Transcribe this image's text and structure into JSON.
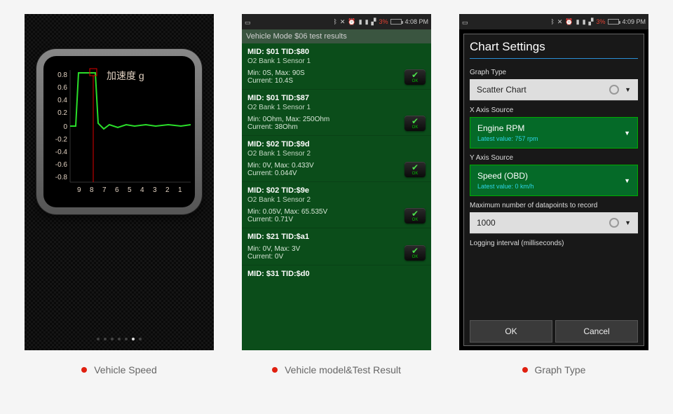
{
  "statusbar": {
    "battery_pct": "3%",
    "time2": "4:08 PM",
    "time3": "4:09 PM"
  },
  "phone1": {
    "chart_title": "加速度 g",
    "y_ticks": [
      "0.8",
      "0.6",
      "0.4",
      "0.2",
      "0",
      "-0.2",
      "-0.4",
      "-0.6",
      "-0.8"
    ],
    "x_ticks": [
      "9",
      "8",
      "7",
      "6",
      "5",
      "4",
      "3",
      "2",
      "1"
    ]
  },
  "chart_data": {
    "type": "line",
    "title": "加速度 g",
    "xlabel": "",
    "ylabel": "g",
    "ylim": [
      -0.8,
      0.8
    ],
    "x": [
      9,
      8,
      7,
      6,
      5,
      4,
      3,
      2,
      1
    ],
    "values": [
      0.0,
      0.82,
      0.82,
      0.05,
      0.05,
      0.05,
      0.05,
      0.05,
      0.05
    ],
    "annotations": [
      "high plateau between x≈9 and x≈8, drops near zero with small noise"
    ]
  },
  "phone2": {
    "title": "Vehicle Mode $06 test results",
    "entries": [
      {
        "mid": "MID: $01 TID:$80",
        "sub": "O2 Bank 1 Sensor 1",
        "minmax": "Min: 0S, Max: 90S",
        "current": "Current: 10.4S"
      },
      {
        "mid": "MID: $01 TID:$87",
        "sub": "O2 Bank 1 Sensor 1",
        "minmax": "Min: 0Ohm, Max: 250Ohm",
        "current": "Current: 38Ohm"
      },
      {
        "mid": "MID: $02 TID:$9d",
        "sub": "O2 Bank 1 Sensor 2",
        "minmax": "Min: 0V, Max: 0.433V",
        "current": "Current: 0.044V"
      },
      {
        "mid": "MID: $02 TID:$9e",
        "sub": "O2 Bank 1 Sensor 2",
        "minmax": "Min: 0.05V, Max: 65.535V",
        "current": "Current: 0.71V"
      },
      {
        "mid": "MID: $21 TID:$a1",
        "sub": "",
        "minmax": "Min: 0V, Max: 3V",
        "current": "Current: 0V"
      },
      {
        "mid": "MID: $31 TID:$d0",
        "sub": "",
        "minmax": "",
        "current": ""
      }
    ],
    "ok_label": "OK"
  },
  "phone3": {
    "title": "Chart Settings",
    "labels": {
      "graph_type": "Graph Type",
      "x_axis": "X Axis Source",
      "y_axis": "Y Axis Source",
      "max_points": "Maximum number of datapoints to record",
      "interval": "Logging interval (milliseconds)"
    },
    "graph_type_value": "Scatter Chart",
    "x_axis_value": "Engine RPM",
    "x_axis_latest": "Latest value: 757 rpm",
    "y_axis_value": "Speed (OBD)",
    "y_axis_latest": "Latest value: 0 km/h",
    "max_points_value": "1000",
    "ok": "OK",
    "cancel": "Cancel"
  },
  "captions": {
    "c1": "Vehicle Speed",
    "c2": "Vehicle model&Test Result",
    "c3": "Graph Type"
  }
}
